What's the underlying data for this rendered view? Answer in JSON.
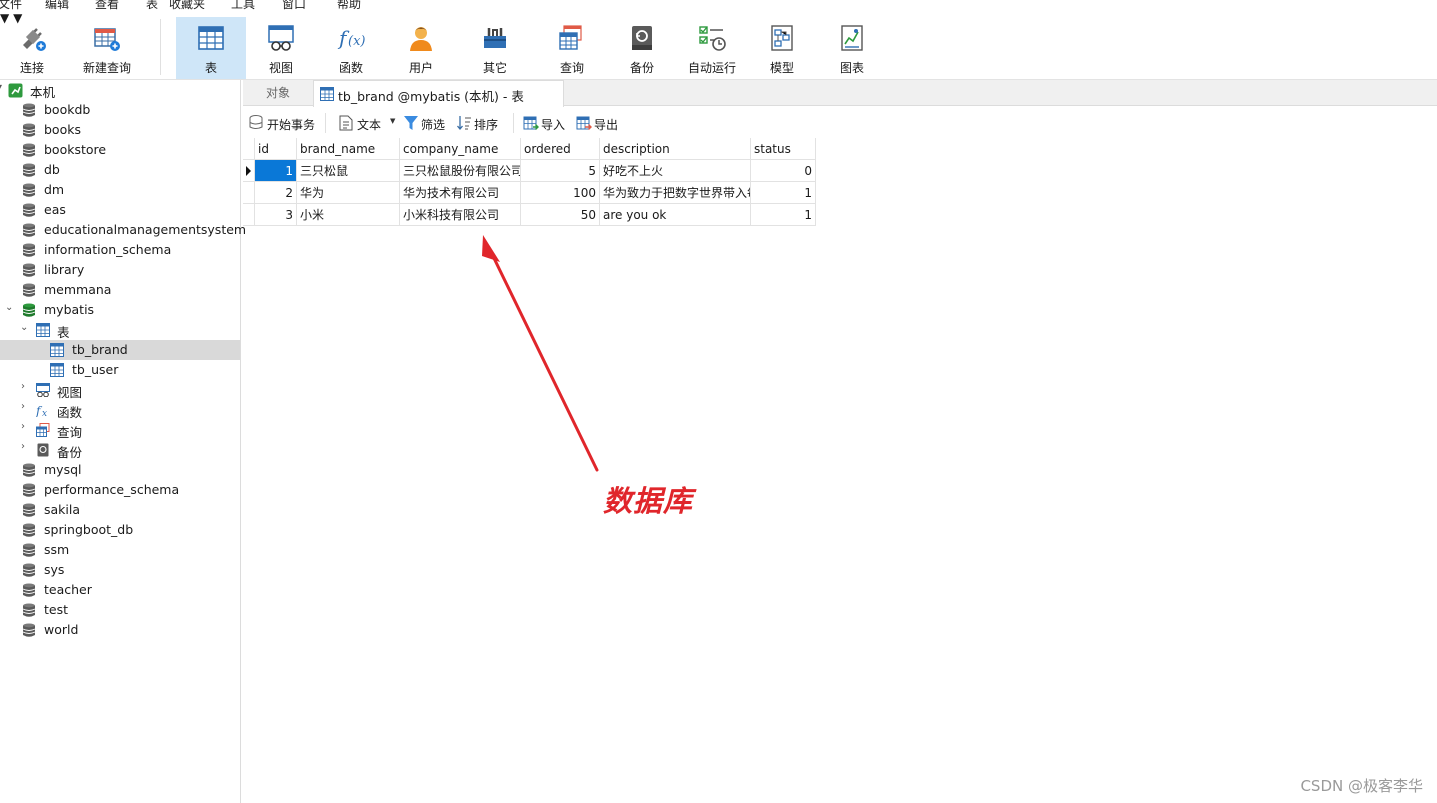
{
  "menu": [
    "文件",
    "编辑",
    "查看",
    "表",
    "收藏夹",
    "工具",
    "窗口",
    "帮助"
  ],
  "toolbar": {
    "connect": "连接",
    "new_query": "新建查询",
    "table": "表",
    "view": "视图",
    "function": "函数",
    "user": "用户",
    "other": "其它",
    "query": "查询",
    "backup": "备份",
    "automation": "自动运行",
    "model": "模型",
    "chart": "图表",
    "active": "table"
  },
  "tree": {
    "root": "本机",
    "databases_before": [
      "bookdb",
      "books",
      "bookstore",
      "db",
      "dm",
      "eas",
      "educationalmanagementsystem",
      "information_schema",
      "library",
      "memmana"
    ],
    "open_db": "mybatis",
    "tables_folder": "表",
    "tables": [
      "tb_brand",
      "tb_user"
    ],
    "selected_table": "tb_brand",
    "subfolders": [
      "视图",
      "函数",
      "查询",
      "备份"
    ],
    "databases_after": [
      "mysql",
      "performance_schema",
      "sakila",
      "springboot_db",
      "ssm",
      "sys",
      "teacher",
      "test",
      "world"
    ]
  },
  "tabs": {
    "objects": "对象",
    "active": "tb_brand @mybatis (本机) - 表"
  },
  "subtoolbar": {
    "begin_tx": "开始事务",
    "text": "文本",
    "filter": "筛选",
    "sort": "排序",
    "import": "导入",
    "export": "导出"
  },
  "grid": {
    "columns": [
      "id",
      "brand_name",
      "company_name",
      "ordered",
      "description",
      "status"
    ],
    "rows": [
      [
        "1",
        "三只松鼠",
        "三只松鼠股份有限公司",
        "5",
        "好吃不上火",
        "0"
      ],
      [
        "2",
        "华为",
        "华为技术有限公司",
        "100",
        "华为致力于把数字世界带入每",
        "1"
      ],
      [
        "3",
        "小米",
        "小米科技有限公司",
        "50",
        "are you ok",
        "1"
      ]
    ]
  },
  "annotation": {
    "label": "数据库",
    "color": "#e0262b"
  },
  "watermark": "CSDN @极客李华"
}
